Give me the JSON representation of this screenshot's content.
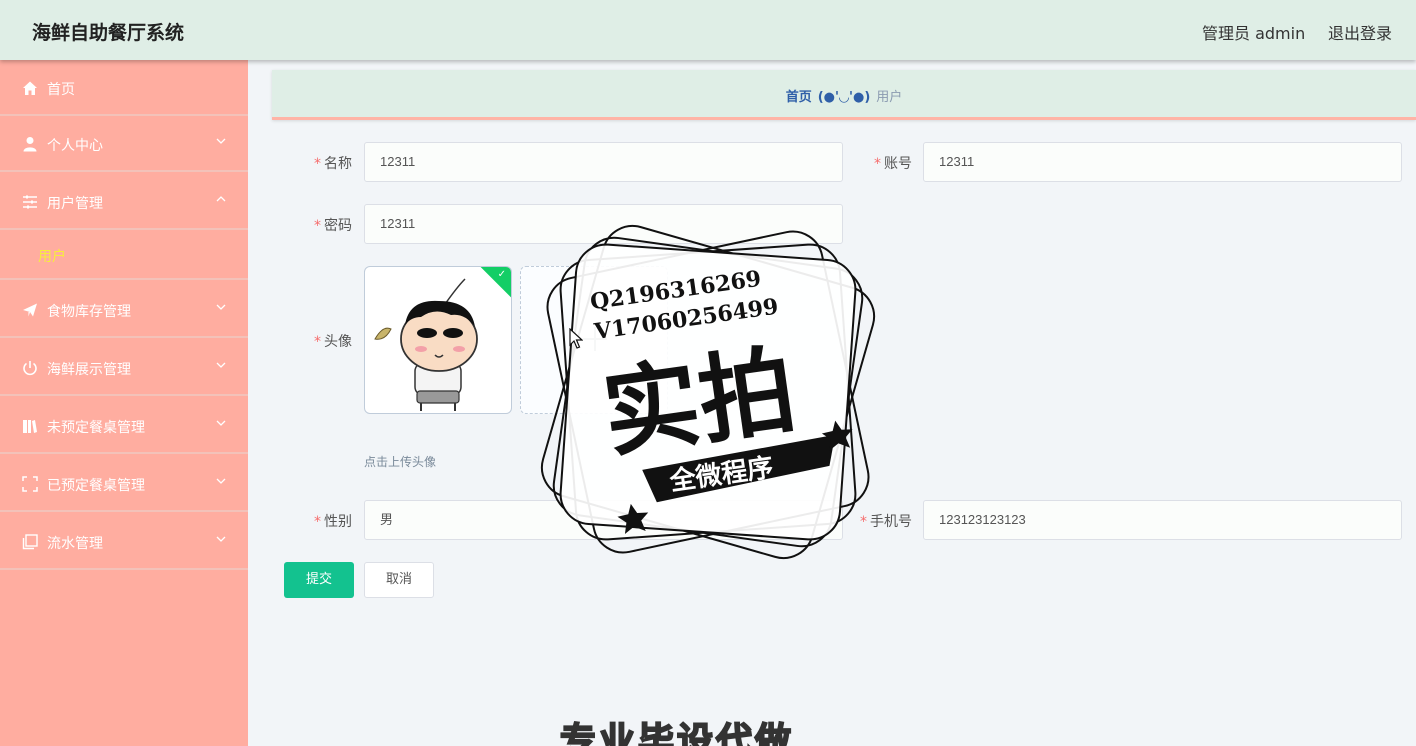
{
  "header": {
    "app_title": "海鲜自助餐厅系统",
    "admin_label": "管理员 admin",
    "logout_label": "退出登录"
  },
  "sidebar": {
    "items": [
      {
        "label": "首页",
        "icon": "home-icon"
      },
      {
        "label": "个人中心",
        "icon": "user-icon"
      },
      {
        "label": "用户管理",
        "icon": "sliders-icon",
        "expanded": true
      },
      {
        "label": "食物库存管理",
        "icon": "send-icon"
      },
      {
        "label": "海鲜展示管理",
        "icon": "power-icon"
      },
      {
        "label": "未预定餐桌管理",
        "icon": "book-icon"
      },
      {
        "label": "已预定餐桌管理",
        "icon": "fullscreen-icon"
      },
      {
        "label": "流水管理",
        "icon": "copy-icon"
      }
    ],
    "submenu": {
      "label": "用户"
    }
  },
  "breadcrumb": {
    "home": "首页",
    "separator": "(●'◡'●)",
    "current": "用户"
  },
  "form": {
    "name": {
      "label": "名称",
      "value": "12311"
    },
    "account": {
      "label": "账号",
      "value": "12311"
    },
    "password": {
      "label": "密码",
      "value": "12311"
    },
    "avatar": {
      "label": "头像",
      "upload_tip": "点击上传头像"
    },
    "gender": {
      "label": "性别",
      "value": "男"
    },
    "phone": {
      "label": "手机号",
      "value": "123123123123"
    }
  },
  "actions": {
    "submit": "提交",
    "cancel": "取消"
  },
  "watermark": {
    "line1": "Q2196316269",
    "line2": "V17060256499",
    "main": "实拍",
    "banner": "全微程序",
    "bottom": "专业毕设代做"
  },
  "colors": {
    "header_bg": "#dfeee6",
    "sidebar_bg": "#ffada0",
    "submenu_active": "#f7ee3a",
    "primary": "#13c28f",
    "required": "#f56c6c"
  }
}
